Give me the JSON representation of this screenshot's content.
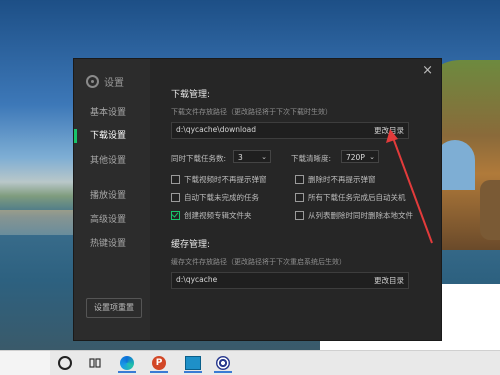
{
  "settings": {
    "title": "设置",
    "close_glyph": "×",
    "nav": [
      {
        "label": "基本设置",
        "active": false
      },
      {
        "label": "下载设置",
        "active": true
      },
      {
        "label": "其他设置",
        "active": false
      },
      {
        "label": "播放设置",
        "active": false
      },
      {
        "label": "高级设置",
        "active": false
      },
      {
        "label": "热键设置",
        "active": false
      }
    ],
    "reset_label": "设置项重置",
    "download": {
      "section_title": "下载管理:",
      "path_hint": "下载文件存放路径（更改路径将于下次下载时生效）",
      "path_value": "d:\\qycache\\download",
      "change_dir_label": "更改目录",
      "concurrent_label": "同时下载任务数:",
      "concurrent_value": "3",
      "quality_label": "下载清晰度:",
      "quality_value": "720P",
      "options": [
        {
          "label": "下载视频时不再提示弹窗",
          "checked": false
        },
        {
          "label": "删除时不再提示弹窗",
          "checked": false
        },
        {
          "label": "自动下载未完成的任务",
          "checked": false
        },
        {
          "label": "所有下载任务完成后自动关机",
          "checked": false
        },
        {
          "label": "创建视频专辑文件夹",
          "checked": true
        },
        {
          "label": "从列表删除时同时删除本地文件",
          "checked": false
        }
      ]
    },
    "cache": {
      "section_title": "缓存管理:",
      "path_hint": "缓存文件存放路径（更改路径将于下次重启系统后生效）",
      "path_value": "d:\\qycache",
      "change_dir_label": "更改目录"
    }
  },
  "taskbar": {
    "icons": [
      "search-circle-icon",
      "task-view-icon",
      "edge-icon",
      "powerpoint-icon",
      "photos-icon",
      "app-icon"
    ],
    "ppt_letter": "P"
  },
  "colors": {
    "accent": "#19c36b",
    "annotation_arrow": "#e23b3b"
  }
}
